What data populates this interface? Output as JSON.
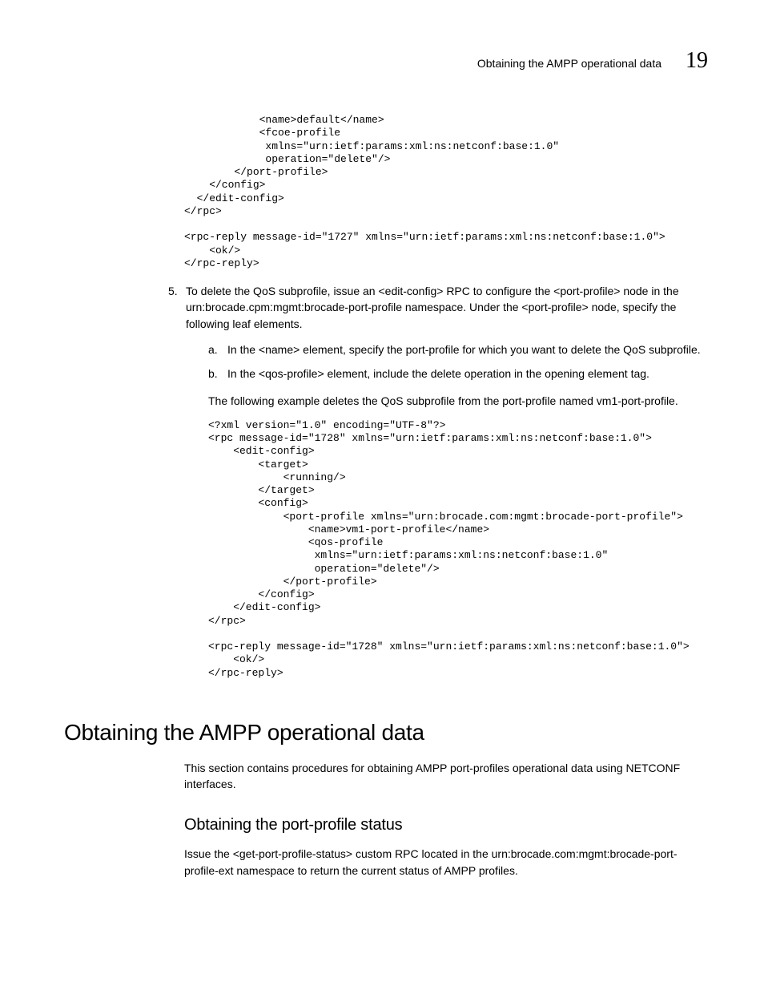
{
  "header": {
    "running_title": "Obtaining the AMPP operational data",
    "chapter": "19"
  },
  "code1": "            <name>default</name>\n            <fcoe-profile\n             xmlns=\"urn:ietf:params:xml:ns:netconf:base:1.0\"\n             operation=\"delete\"/>\n        </port-profile>\n    </config>\n  </edit-config>\n</rpc>\n\n<rpc-reply message-id=\"1727\" xmlns=\"urn:ietf:params:xml:ns:netconf:base:1.0\">\n    <ok/>\n</rpc-reply>",
  "step5": {
    "marker": "5.",
    "text": "To delete the QoS subprofile, issue an <edit-config> RPC to configure the <port-profile> node in the urn:brocade.cpm:mgmt:brocade-port-profile namespace. Under the <port-profile> node, specify the following leaf elements."
  },
  "substeps": {
    "a": {
      "marker": "a.",
      "text": "In the <name> element, specify the port-profile for which you want to delete the QoS subprofile."
    },
    "b": {
      "marker": "b.",
      "text": "In the <qos-profile> element, include the delete operation in the opening element tag."
    }
  },
  "example_para": "The following example deletes the QoS subprofile from the port-profile named vm1-port-profile.",
  "code2": "<?xml version=\"1.0\" encoding=\"UTF-8\"?>\n<rpc message-id=\"1728\" xmlns=\"urn:ietf:params:xml:ns:netconf:base:1.0\">\n    <edit-config>\n        <target>\n            <running/>\n        </target>\n        <config>\n            <port-profile xmlns=\"urn:brocade.com:mgmt:brocade-port-profile\">\n                <name>vm1-port-profile</name>\n                <qos-profile\n                 xmlns=\"urn:ietf:params:xml:ns:netconf:base:1.0\"\n                 operation=\"delete\"/>\n            </port-profile>\n        </config>\n    </edit-config>\n</rpc>\n\n<rpc-reply message-id=\"1728\" xmlns=\"urn:ietf:params:xml:ns:netconf:base:1.0\">\n    <ok/>\n</rpc-reply>",
  "section": {
    "h1": "Obtaining the AMPP operational data",
    "intro": "This section contains procedures for obtaining AMPP port-profiles operational data using NETCONF interfaces.",
    "h2": "Obtaining the port-profile status",
    "body": "Issue the <get-port-profile-status> custom RPC located in the urn:brocade.com:mgmt:brocade-port-profile-ext namespace to return the current status of AMPP profiles."
  }
}
